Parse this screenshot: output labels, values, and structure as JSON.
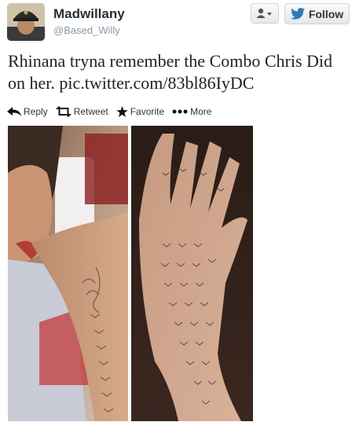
{
  "user": {
    "name": "Madwillany",
    "handle": "@Based_Willy",
    "avatar_icon": "profile-avatar"
  },
  "buttons": {
    "user_menu_icon": "user-dropdown-icon",
    "follow_label": "Follow",
    "follow_icon": "twitter-bird-icon"
  },
  "tweet": {
    "text": "Rhinana tryna remember the Combo Chris Did on her.",
    "link": "pic.twitter.com/83bl86IyDC"
  },
  "actions": {
    "reply": "Reply",
    "retweet": "Retweet",
    "favorite": "Favorite",
    "more": "More"
  },
  "colors": {
    "accent_blue": "#2b7bb9",
    "link": "#222222",
    "muted": "#8899a6"
  }
}
